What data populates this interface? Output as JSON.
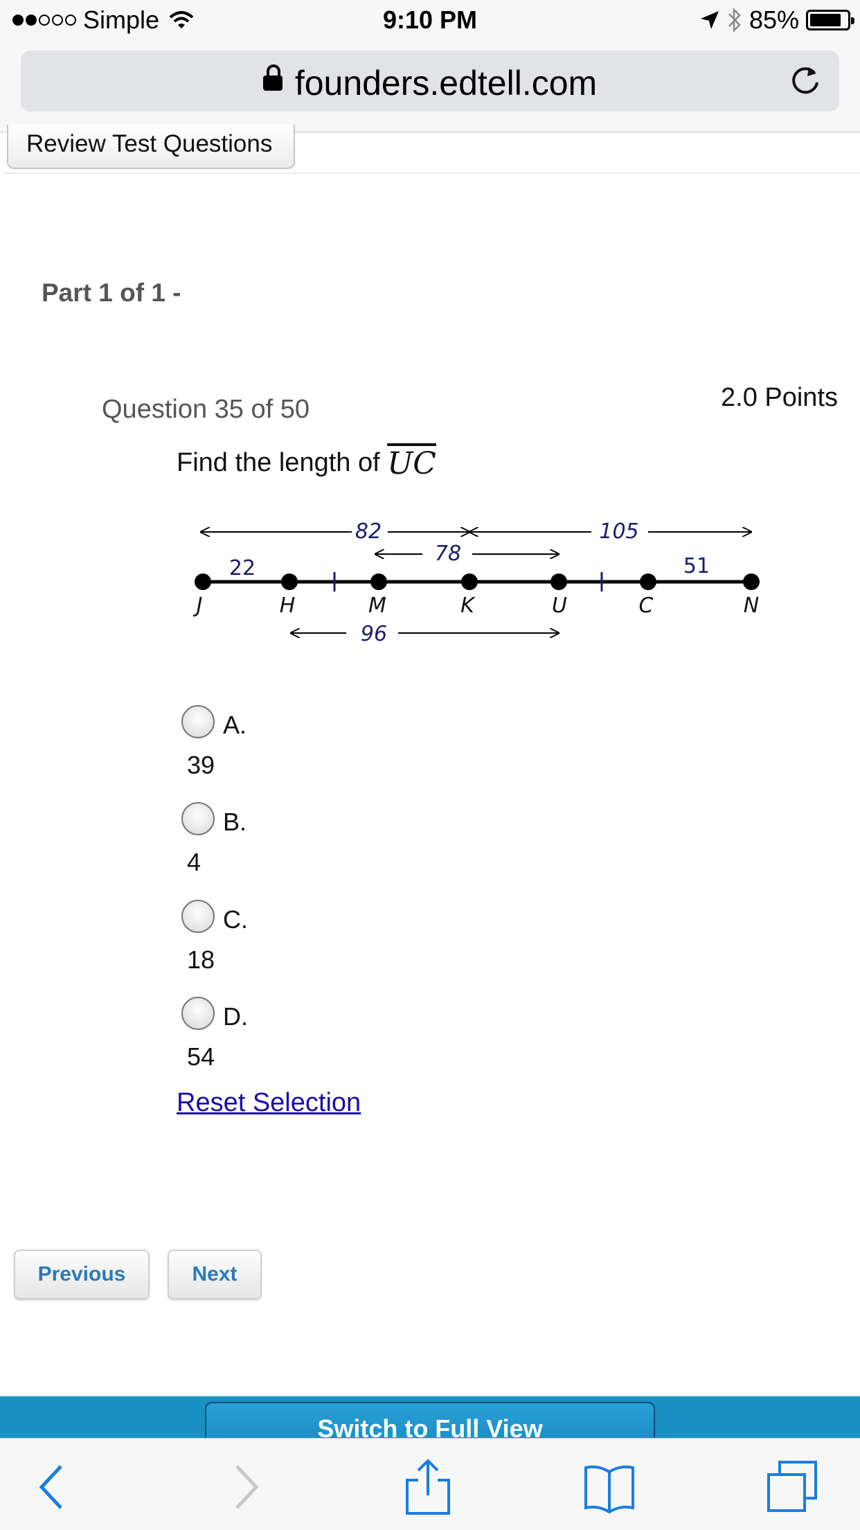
{
  "status_bar": {
    "carrier": "Simple",
    "time": "9:10 PM",
    "battery": "85%",
    "battery_level": 0.85
  },
  "browser": {
    "url": "founders.edtell.com"
  },
  "page": {
    "review_tab_label": "Review Test Questions",
    "part_title": "Part 1 of 1 -",
    "question_number": "Question 35 of 50",
    "points": "2.0 Points",
    "prompt_text": "Find the length of ",
    "segment_name": "UC"
  },
  "figure": {
    "point_labels": [
      "J",
      "H",
      "M",
      "K",
      "U",
      "C",
      "N"
    ],
    "segment_labels": {
      "jh": "22",
      "jk": "82",
      "kn": "105",
      "mu": "78",
      "cn": "51",
      "hu": "96"
    }
  },
  "choices": [
    {
      "letter": "A.",
      "value": "39"
    },
    {
      "letter": "B.",
      "value": "4"
    },
    {
      "letter": "C.",
      "value": "18"
    },
    {
      "letter": "D.",
      "value": "54"
    }
  ],
  "reset_label": "Reset Selection",
  "nav": {
    "previous": "Previous",
    "next": "Next"
  },
  "footer": {
    "switch_view": "Switch to Full View"
  }
}
